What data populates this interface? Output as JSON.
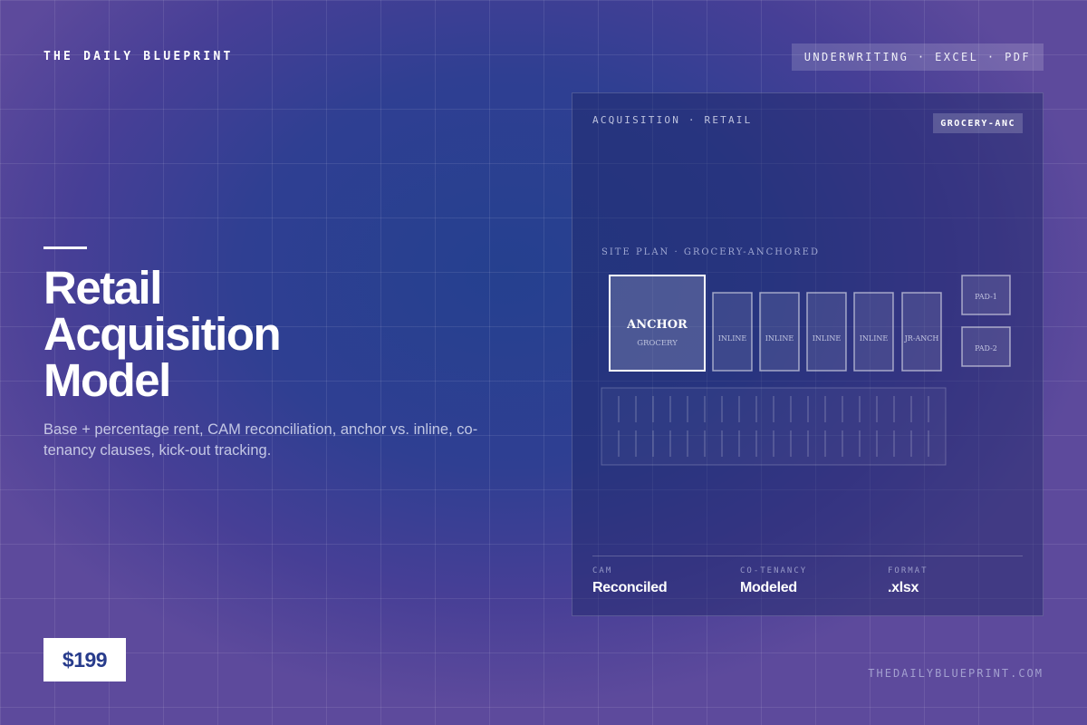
{
  "header": {
    "brand": "THE DAILY BLUEPRINT",
    "tag": "UNDERWRITING · EXCEL · PDF"
  },
  "hero": {
    "title_lines": [
      "Retail",
      "Acquisition",
      "Model"
    ],
    "subtitle": "Base + percentage rent, CAM reconciliation, anchor vs. inline, co-tenancy clauses, kick-out tracking.",
    "price": "$199"
  },
  "footer": {
    "url": "THEDAILYBLUEPRINT.COM"
  },
  "card": {
    "label": "ACQUISITION · RETAIL",
    "badge": "GROCERY-ANC",
    "site_plan": {
      "title": "SITE PLAN · GROCERY-ANCHORED",
      "anchor_label": "ANCHOR",
      "anchor_sub": "GROCERY",
      "units": [
        "INLINE",
        "INLINE",
        "INLINE",
        "INLINE",
        "JR-ANCH"
      ],
      "pads": [
        "PAD-1",
        "PAD-2"
      ]
    },
    "stats": [
      {
        "label": "CAM",
        "value": "Reconciled"
      },
      {
        "label": "CO-TENANCY",
        "value": "Modeled"
      },
      {
        "label": "FORMAT",
        "value": ".xlsx"
      }
    ]
  },
  "colors": {
    "accent": "#283c8c",
    "background": "#2f3f92"
  }
}
